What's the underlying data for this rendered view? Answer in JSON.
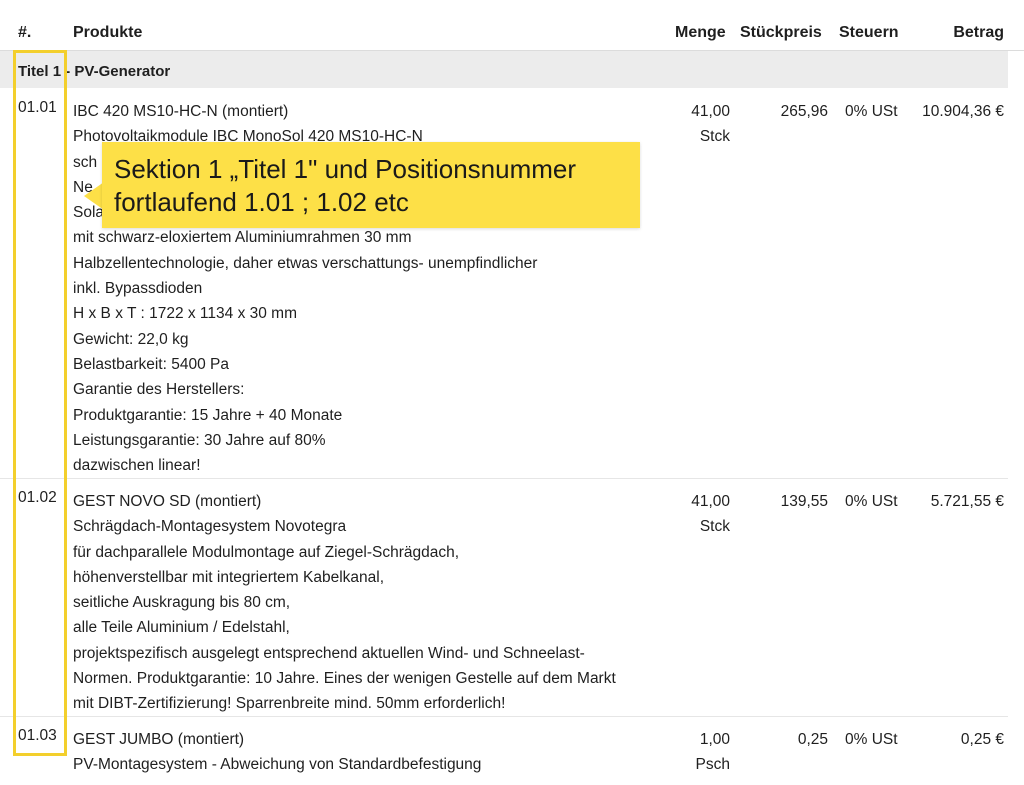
{
  "table": {
    "headers": {
      "num": "#.",
      "products": "Produkte",
      "quantity": "Menge",
      "unit_price": "Stückpreis",
      "tax": "Steuern",
      "amount": "Betrag"
    },
    "section_title": "Titel 1 - PV-Generator",
    "rows": [
      {
        "pos": "01.01",
        "lines": [
          "IBC 420 MS10-HC-N (montiert)",
          "Photovoltaikmodule IBC MonoSol 420 MS10-HC-N",
          "sch",
          "Ne",
          "Sola",
          "mit schwarz-eloxiertem Aluminiumrahmen 30 mm",
          "Halbzellentechnologie, daher etwas verschattungs- unempfindlicher",
          "inkl. Bypassdioden",
          "H x B x T : 1722 x 1134 x 30 mm",
          "Gewicht: 22,0 kg",
          "Belastbarkeit: 5400 Pa",
          "Garantie des Herstellers:",
          "Produktgarantie: 15 Jahre + 40 Monate",
          "Leistungsgarantie: 30 Jahre auf 80%",
          "dazwischen linear!"
        ],
        "quantity": "41,00",
        "unit": "Stck",
        "unit_price": "265,96",
        "tax": "0% USt",
        "amount": "10.904,36 €"
      },
      {
        "pos": "01.02",
        "lines": [
          "GEST NOVO SD (montiert)",
          "Schrägdach-Montagesystem Novotegra",
          "für dachparallele Modulmontage auf Ziegel-Schrägdach,",
          "höhenverstellbar mit integriertem Kabelkanal,",
          "seitliche Auskragung bis 80 cm,",
          "alle Teile Aluminium / Edelstahl,",
          "projektspezifisch ausgelegt entsprechend aktuellen Wind- und Schneelast-",
          "Normen. Produktgarantie: 10 Jahre. Eines der wenigen Gestelle auf dem Markt",
          "mit DIBT-Zertifizierung! Sparrenbreite mind. 50mm erforderlich!"
        ],
        "quantity": "41,00",
        "unit": "Stck",
        "unit_price": "139,55",
        "tax": "0% USt",
        "amount": "5.721,55 €"
      },
      {
        "pos": "01.03",
        "lines": [
          "GEST JUMBO (montiert)",
          "PV-Montagesystem - Abweichung von Standardbefestigung"
        ],
        "quantity": "1,00",
        "unit": "Psch",
        "unit_price": "0,25",
        "tax": "0% USt",
        "amount": "0,25 €"
      }
    ]
  },
  "annotation": {
    "line1": "Sektion 1 „Titel 1\" und Positionsnummer",
    "line2": "fortlaufend 1.01 ; 1.02 etc"
  },
  "colors": {
    "highlight": "#fde047",
    "highlight_border": "#f3cf2c",
    "section_bg": "#ececec"
  }
}
